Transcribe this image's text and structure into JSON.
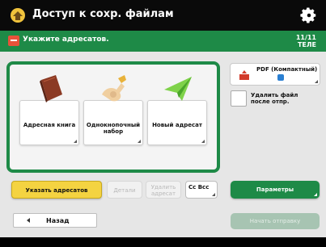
{
  "header": {
    "title": "Доступ к сохр. файлам"
  },
  "subheader": {
    "text": "Укажите адресатов.",
    "right_line1": "11/11",
    "right_line2": "ТЕЛЕ"
  },
  "tiles": [
    {
      "label": "Адресная книга",
      "icon": "address-book-icon"
    },
    {
      "label": "Однокнопочный набор",
      "icon": "one-touch-icon"
    },
    {
      "label": "Новый адресат",
      "icon": "paper-plane-icon"
    }
  ],
  "actions": {
    "specify_label": "Указать адресатов",
    "details_label": "Детали",
    "delete_label": "Удалить адресат",
    "cc_label": "Cc Bcc"
  },
  "right_panel": {
    "file_format_label": "PDF (Компактный)",
    "delete_file_label": "Удалить файл после отпр.",
    "params_label": "Параметры",
    "send_label": "Начать отправку"
  },
  "nav": {
    "back_label": "Назад"
  },
  "colors": {
    "accent_green": "#1e8a47",
    "highlight_yellow": "#f4d341",
    "icon_red": "#e8523a"
  }
}
